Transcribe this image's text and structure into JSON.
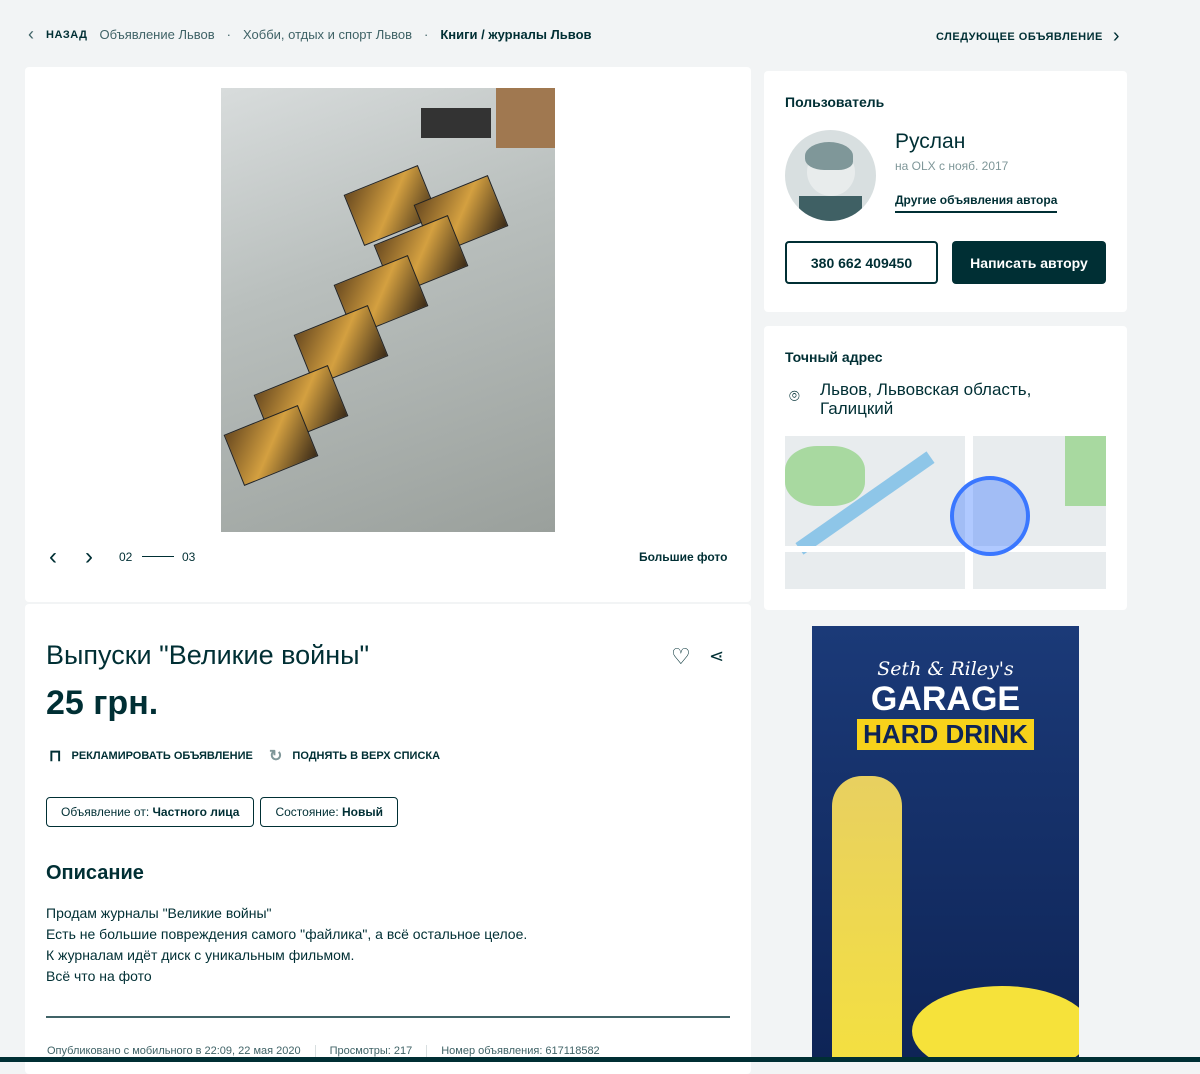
{
  "breadcrumb": {
    "back": "НАЗАД",
    "items": [
      "Объявление Львов",
      "Хобби, отдых и спорт Львов",
      "Книги / журналы Львов"
    ],
    "next": "СЛЕДУЮЩЕЕ ОБЪЯВЛЕНИЕ"
  },
  "gallery": {
    "current": "02",
    "total": "03",
    "big_photos": "Большие фото"
  },
  "ad": {
    "title": "Выпуски \"Великие войны\"",
    "price": "25 грн.",
    "promote": "РЕКЛАМИРОВАТЬ ОБЪЯВЛЕНИЕ",
    "raise": "ПОДНЯТЬ В ВЕРХ СПИСКА",
    "tags": [
      {
        "label": "Объявление от: ",
        "value": "Частного лица"
      },
      {
        "label": "Состояние: ",
        "value": "Новый"
      }
    ],
    "description_heading": "Описание",
    "description": [
      "Продам журналы \"Великие войны\"",
      "Есть не большие повреждения самого \"файлика\", а всё остальное целое.",
      "К журналам идёт диск с уникальным фильмом.",
      "Всё что на фото"
    ],
    "published": "Опубликовано с мобильного в 22:09, 22 мая 2020",
    "views": "Просмотры: 217",
    "ad_number": "Номер объявления: 617118582"
  },
  "user": {
    "heading": "Пользователь",
    "name": "Руслан",
    "since": "на OLX с нояб. 2017",
    "other_ads": "Другие объявления автора",
    "phone": "380 662 409450",
    "write": "Написать автору"
  },
  "address": {
    "heading": "Точный адрес",
    "text": "Львов, Львовская область, Галицкий"
  },
  "banner": {
    "brand_top": "Seth & Riley's",
    "brand": "GARAGE",
    "product": "HARD DRINK"
  },
  "colors": {
    "primary": "#002f34",
    "accent": "#3a77ff"
  }
}
